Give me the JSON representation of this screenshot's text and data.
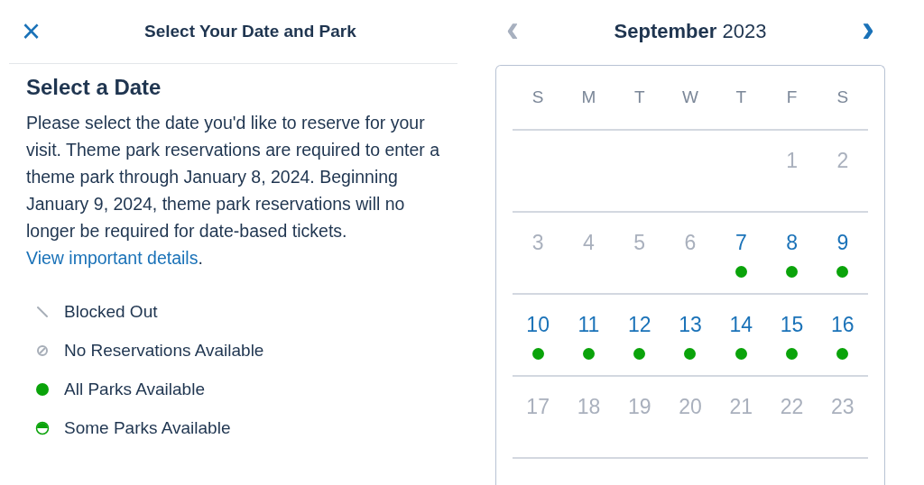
{
  "header": {
    "close_icon": "×",
    "title": "Select Your Date and Park"
  },
  "section": {
    "heading": "Select a Date",
    "text": "Please select the date you'd like to reserve for your visit. Theme park reservations are required to enter a theme park through January 8, 2024. Beginning January 9, 2024, theme park reservations will no longer be required for date-based tickets.",
    "link": "View important details",
    "after_link": "."
  },
  "legend": [
    {
      "kind": "blocked",
      "label": "Blocked Out"
    },
    {
      "kind": "none",
      "label": "No Reservations Available"
    },
    {
      "kind": "all",
      "label": "All Parks Available"
    },
    {
      "kind": "some",
      "label": "Some Parks Available"
    }
  ],
  "calendar": {
    "prev": {
      "symbol": "‹",
      "disabled": true
    },
    "month": "**September** 2023",
    "next": {
      "symbol": "›",
      "disabled": false
    },
    "weekdays": [
      "S",
      "M",
      "T",
      "W",
      "T",
      "F",
      "S"
    ],
    "weeks": [
      [
        {
          "day": "1",
          "available": false
        },
        {
          "day": "2",
          "available": false
        }
      ],
      [
        {
          "day": "3",
          "available": false
        },
        {
          "day": "4",
          "available": false
        },
        {
          "day": "5",
          "available": false
        },
        {
          "day": "6",
          "available": false
        },
        {
          "day": "7",
          "available": true
        },
        {
          "day": "8",
          "available": true
        },
        {
          "day": "9",
          "available": true
        }
      ],
      [
        {
          "day": "10",
          "available": true
        },
        {
          "day": "11",
          "available": true
        },
        {
          "day": "12",
          "available": true
        },
        {
          "day": "13",
          "available": true
        },
        {
          "day": "14",
          "available": true
        },
        {
          "day": "15",
          "available": true
        },
        {
          "day": "16",
          "available": true
        }
      ],
      [
        {
          "day": "17",
          "available": false
        },
        {
          "day": "18",
          "available": false
        },
        {
          "day": "19",
          "available": false
        },
        {
          "day": "20",
          "available": false
        },
        {
          "day": "21",
          "available": false
        },
        {
          "day": "22",
          "available": false
        },
        {
          "day": "23",
          "available": false
        }
      ]
    ]
  }
}
